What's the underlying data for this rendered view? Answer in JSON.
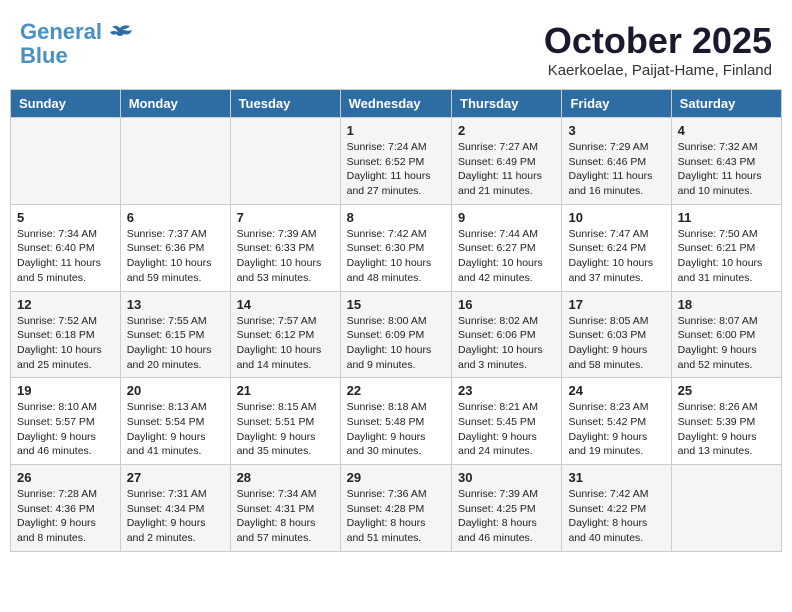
{
  "header": {
    "logo_line1": "General",
    "logo_line2": "Blue",
    "month": "October 2025",
    "location": "Kaerkoelae, Paijat-Hame, Finland"
  },
  "weekdays": [
    "Sunday",
    "Monday",
    "Tuesday",
    "Wednesday",
    "Thursday",
    "Friday",
    "Saturday"
  ],
  "weeks": [
    [
      {
        "day": "",
        "info": ""
      },
      {
        "day": "",
        "info": ""
      },
      {
        "day": "",
        "info": ""
      },
      {
        "day": "1",
        "info": "Sunrise: 7:24 AM\nSunset: 6:52 PM\nDaylight: 11 hours\nand 27 minutes."
      },
      {
        "day": "2",
        "info": "Sunrise: 7:27 AM\nSunset: 6:49 PM\nDaylight: 11 hours\nand 21 minutes."
      },
      {
        "day": "3",
        "info": "Sunrise: 7:29 AM\nSunset: 6:46 PM\nDaylight: 11 hours\nand 16 minutes."
      },
      {
        "day": "4",
        "info": "Sunrise: 7:32 AM\nSunset: 6:43 PM\nDaylight: 11 hours\nand 10 minutes."
      }
    ],
    [
      {
        "day": "5",
        "info": "Sunrise: 7:34 AM\nSunset: 6:40 PM\nDaylight: 11 hours\nand 5 minutes."
      },
      {
        "day": "6",
        "info": "Sunrise: 7:37 AM\nSunset: 6:36 PM\nDaylight: 10 hours\nand 59 minutes."
      },
      {
        "day": "7",
        "info": "Sunrise: 7:39 AM\nSunset: 6:33 PM\nDaylight: 10 hours\nand 53 minutes."
      },
      {
        "day": "8",
        "info": "Sunrise: 7:42 AM\nSunset: 6:30 PM\nDaylight: 10 hours\nand 48 minutes."
      },
      {
        "day": "9",
        "info": "Sunrise: 7:44 AM\nSunset: 6:27 PM\nDaylight: 10 hours\nand 42 minutes."
      },
      {
        "day": "10",
        "info": "Sunrise: 7:47 AM\nSunset: 6:24 PM\nDaylight: 10 hours\nand 37 minutes."
      },
      {
        "day": "11",
        "info": "Sunrise: 7:50 AM\nSunset: 6:21 PM\nDaylight: 10 hours\nand 31 minutes."
      }
    ],
    [
      {
        "day": "12",
        "info": "Sunrise: 7:52 AM\nSunset: 6:18 PM\nDaylight: 10 hours\nand 25 minutes."
      },
      {
        "day": "13",
        "info": "Sunrise: 7:55 AM\nSunset: 6:15 PM\nDaylight: 10 hours\nand 20 minutes."
      },
      {
        "day": "14",
        "info": "Sunrise: 7:57 AM\nSunset: 6:12 PM\nDaylight: 10 hours\nand 14 minutes."
      },
      {
        "day": "15",
        "info": "Sunrise: 8:00 AM\nSunset: 6:09 PM\nDaylight: 10 hours\nand 9 minutes."
      },
      {
        "day": "16",
        "info": "Sunrise: 8:02 AM\nSunset: 6:06 PM\nDaylight: 10 hours\nand 3 minutes."
      },
      {
        "day": "17",
        "info": "Sunrise: 8:05 AM\nSunset: 6:03 PM\nDaylight: 9 hours\nand 58 minutes."
      },
      {
        "day": "18",
        "info": "Sunrise: 8:07 AM\nSunset: 6:00 PM\nDaylight: 9 hours\nand 52 minutes."
      }
    ],
    [
      {
        "day": "19",
        "info": "Sunrise: 8:10 AM\nSunset: 5:57 PM\nDaylight: 9 hours\nand 46 minutes."
      },
      {
        "day": "20",
        "info": "Sunrise: 8:13 AM\nSunset: 5:54 PM\nDaylight: 9 hours\nand 41 minutes."
      },
      {
        "day": "21",
        "info": "Sunrise: 8:15 AM\nSunset: 5:51 PM\nDaylight: 9 hours\nand 35 minutes."
      },
      {
        "day": "22",
        "info": "Sunrise: 8:18 AM\nSunset: 5:48 PM\nDaylight: 9 hours\nand 30 minutes."
      },
      {
        "day": "23",
        "info": "Sunrise: 8:21 AM\nSunset: 5:45 PM\nDaylight: 9 hours\nand 24 minutes."
      },
      {
        "day": "24",
        "info": "Sunrise: 8:23 AM\nSunset: 5:42 PM\nDaylight: 9 hours\nand 19 minutes."
      },
      {
        "day": "25",
        "info": "Sunrise: 8:26 AM\nSunset: 5:39 PM\nDaylight: 9 hours\nand 13 minutes."
      }
    ],
    [
      {
        "day": "26",
        "info": "Sunrise: 7:28 AM\nSunset: 4:36 PM\nDaylight: 9 hours\nand 8 minutes."
      },
      {
        "day": "27",
        "info": "Sunrise: 7:31 AM\nSunset: 4:34 PM\nDaylight: 9 hours\nand 2 minutes."
      },
      {
        "day": "28",
        "info": "Sunrise: 7:34 AM\nSunset: 4:31 PM\nDaylight: 8 hours\nand 57 minutes."
      },
      {
        "day": "29",
        "info": "Sunrise: 7:36 AM\nSunset: 4:28 PM\nDaylight: 8 hours\nand 51 minutes."
      },
      {
        "day": "30",
        "info": "Sunrise: 7:39 AM\nSunset: 4:25 PM\nDaylight: 8 hours\nand 46 minutes."
      },
      {
        "day": "31",
        "info": "Sunrise: 7:42 AM\nSunset: 4:22 PM\nDaylight: 8 hours\nand 40 minutes."
      },
      {
        "day": "",
        "info": ""
      }
    ]
  ]
}
